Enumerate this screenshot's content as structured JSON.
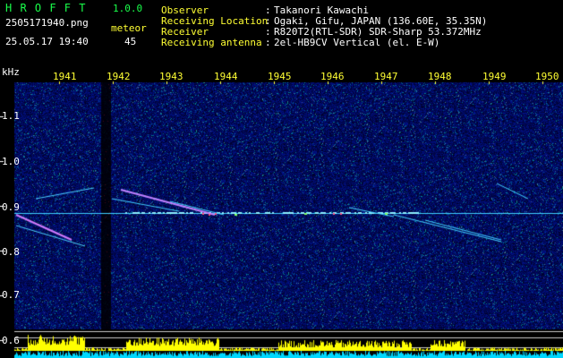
{
  "app": {
    "name": "H R O F F T",
    "version": "1.0.0"
  },
  "capture": {
    "filename": "2505171940.png",
    "datetime": "25.05.17 19:40"
  },
  "counter": {
    "label": "meteor",
    "value": "45"
  },
  "info": [
    {
      "key": "Observer",
      "value": "Takanori Kawachi"
    },
    {
      "key": "Receiving Location",
      "value": "Ogaki, Gifu, JAPAN (136.60E, 35.35N)"
    },
    {
      "key": "Receiver",
      "value": "R820T2(RTL-SDR) SDR-Sharp 53.372MHz"
    },
    {
      "key": "Receiving antenna",
      "value": "2el-HB9CV Vertical (el. E-W)"
    }
  ],
  "axes": {
    "y_unit": "kHz",
    "y_ticks": [
      "1.1",
      "1.0",
      "0.9",
      "0.8",
      "0.7",
      "0.6"
    ],
    "x_ticks": [
      "1941",
      "1942",
      "1943",
      "1944",
      "1945",
      "1946",
      "1947",
      "1948",
      "1949",
      "1950"
    ]
  },
  "colors": {
    "background": "#000000",
    "noise": "#101c8a",
    "header_green": "#19ff4a",
    "tick_yellow": "#ffff33",
    "level_cyan": "#00d8ff"
  }
}
